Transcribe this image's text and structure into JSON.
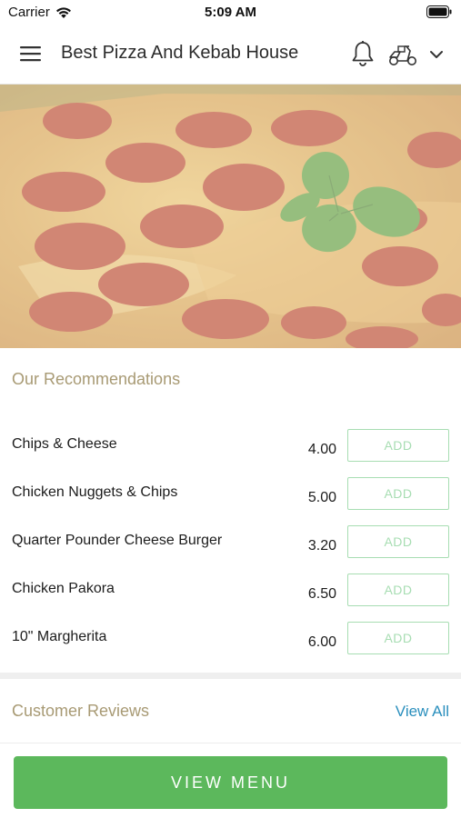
{
  "status_bar": {
    "carrier": "Carrier",
    "time": "5:09 AM",
    "icons": [
      "wifi-icon",
      "battery-icon"
    ]
  },
  "app_bar": {
    "title": "Best Pizza And Kebab House",
    "icons": [
      "hamburger-menu-icon",
      "bell-icon",
      "scooter-icon",
      "chevron-down-icon"
    ]
  },
  "hero": {
    "image": "pepperoni-pizza-with-basil"
  },
  "recommendations": {
    "title": "Our Recommendations",
    "items": [
      {
        "name": "Chips & Cheese",
        "price": "4.00",
        "add_label": "ADD"
      },
      {
        "name": "Chicken Nuggets & Chips",
        "price": "5.00",
        "add_label": "ADD"
      },
      {
        "name": "Quarter Pounder Cheese Burger",
        "price": "3.20",
        "add_label": "ADD"
      },
      {
        "name": "Chicken Pakora",
        "price": "6.50",
        "add_label": "ADD"
      },
      {
        "name": "10\" Margherita",
        "price": "6.00",
        "add_label": "ADD"
      }
    ]
  },
  "reviews": {
    "title": "Customer Reviews",
    "view_all_label": "View All"
  },
  "footer": {
    "view_menu_label": "VIEW MENU"
  },
  "colors": {
    "section_title": "#a89a74",
    "add_button": "#a7ddb2",
    "link": "#2a8fbd",
    "primary_button": "#5cb85c"
  }
}
